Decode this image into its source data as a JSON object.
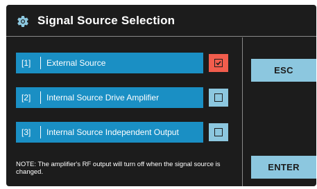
{
  "header": {
    "title": "Signal Source Selection",
    "icon": "gear-icon"
  },
  "options": [
    {
      "number": "[1]",
      "label": "External Source",
      "checked": true
    },
    {
      "number": "[2]",
      "label": "Internal Source Drive Amplifier",
      "checked": false
    },
    {
      "number": "[3]",
      "label": "Internal Source Independent Output",
      "checked": false
    }
  ],
  "note": "NOTE: The amplifier's RF output will turn off when the signal source is changed.",
  "buttons": {
    "esc_label": "ESC",
    "enter_label": "ENTER"
  },
  "colors": {
    "panel_background": "#1c1c1c",
    "option_bar": "#1a8fc4",
    "checkbox_unchecked": "#8cc7df",
    "checkbox_checked": "#f15d4d",
    "button": "#8cc7df",
    "text": "#ffffff"
  }
}
